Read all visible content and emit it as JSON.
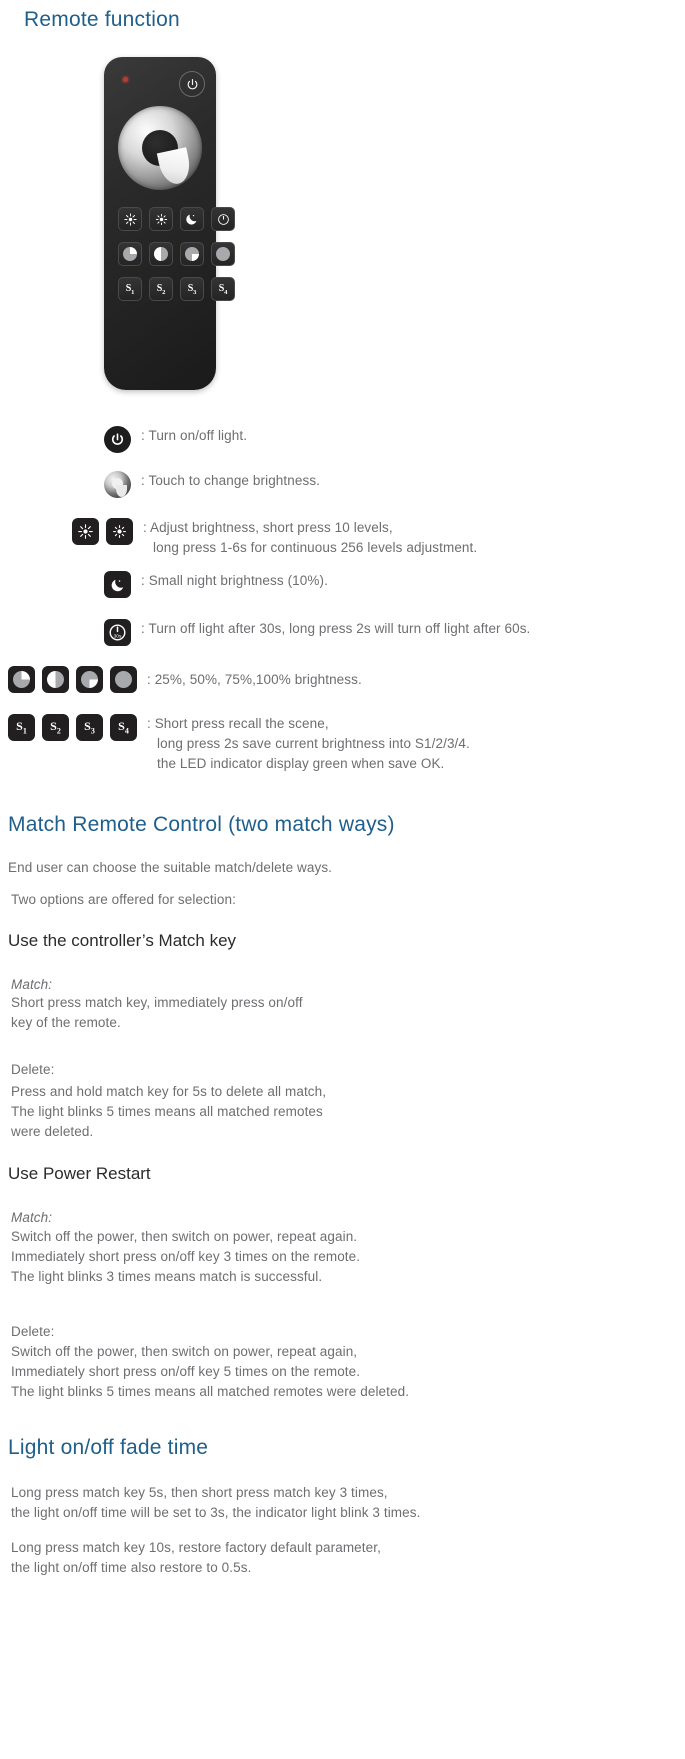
{
  "page": {
    "accent_color": "#1f5f8b",
    "body_color": "#6d6e71",
    "heading_dark": "#2b2b2b"
  },
  "section_remote": {
    "title": "Remote function",
    "device": {
      "name": "led-dimmer-remote",
      "led_indicator_color": "#c0392b",
      "body_color": "#262626",
      "buttons_row1": [
        "brightness-up",
        "brightness-down",
        "night-mode",
        "power-timer"
      ],
      "buttons_row2": [
        "25%",
        "50%",
        "75%",
        "100%"
      ],
      "buttons_row3": [
        "S1",
        "S2",
        "S3",
        "S4"
      ]
    },
    "legend": [
      {
        "icons": [
          "power-icon"
        ],
        "lines": [
          "Turn on/off light."
        ]
      },
      {
        "icons": [
          "touch-wheel-icon"
        ],
        "lines": [
          "Touch to change brightness."
        ]
      },
      {
        "icons": [
          "brightness-up-icon",
          "brightness-down-icon"
        ],
        "lines": [
          "Adjust brightness, short press 10 levels,",
          "long press 1-6s for continuous 256 levels adjustment."
        ]
      },
      {
        "icons": [
          "moon-icon"
        ],
        "lines": [
          "Small night brightness (10%)."
        ]
      },
      {
        "icons": [
          "power-timer-icon"
        ],
        "lines": [
          "Turn off light after 30s, long press 2s will turn off light after 60s."
        ]
      },
      {
        "icons": [
          "pie-25-icon",
          "pie-50-icon",
          "pie-75-icon",
          "pie-100-icon"
        ],
        "lines": [
          "25%, 50%, 75%,100% brightness."
        ]
      },
      {
        "icons": [
          "scene-s1-icon",
          "scene-s2-icon",
          "scene-s3-icon",
          "scene-s4-icon"
        ],
        "lines": [
          "Short press recall the scene,",
          "long press 2s save current brightness into S1/2/3/4.",
          "the LED indicator display green when save OK."
        ]
      }
    ],
    "scene_labels": [
      "S",
      "S",
      "S",
      "S"
    ],
    "scene_subs": [
      "1",
      "2",
      "3",
      "4"
    ],
    "timer_label": "30s"
  },
  "section_match": {
    "title": "Match Remote Control (two match ways)",
    "intro_1": "End user can choose the suitable match/delete ways.",
    "intro_2": "Two options are offered for selection:",
    "option1": {
      "heading": "Use the controller’s Match key",
      "match_label": "Match:",
      "match_lines": [
        "Short press match key, immediately press on/off",
        "key of the remote."
      ],
      "delete_label": "Delete:",
      "delete_lines": [
        "Press and hold match key for 5s to delete all match,",
        "The light blinks 5 times means all matched remotes",
        "were deleted."
      ]
    },
    "option2": {
      "heading": "Use Power Restart",
      "match_label": "Match:",
      "match_lines": [
        "Switch off the power, then switch on power, repeat again.",
        "Immediately short press on/off key 3 times on the remote.",
        "The light blinks 3 times means match is successful."
      ],
      "delete_label": "Delete:",
      "delete_lines": [
        "Switch off the power, then switch on power, repeat again,",
        "Immediately short press on/off key 5 times on the remote.",
        "The light blinks 5 times means all matched remotes were deleted."
      ]
    }
  },
  "section_fade": {
    "title": "Light on/off fade time",
    "para1": [
      "Long press match key 5s, then short press match key 3 times,",
      "the light on/off time will be set to 3s, the indicator light blink 3 times."
    ],
    "para2": [
      "Long press match key 10s, restore factory default parameter,",
      "the light on/off time also restore to 0.5s."
    ]
  }
}
